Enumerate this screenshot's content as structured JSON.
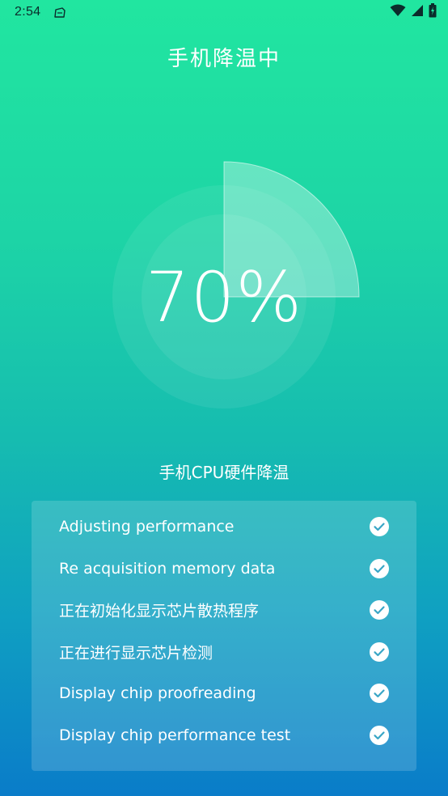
{
  "status_bar": {
    "time": "2:54",
    "icons": [
      "notification-app-icon",
      "wifi-icon",
      "signal-icon",
      "battery-icon"
    ]
  },
  "header": {
    "title": "手机降温中"
  },
  "gauge": {
    "value_text": "70%",
    "progress_fraction": 0.25
  },
  "section": {
    "subtitle": "手机CPU硬件降温"
  },
  "tasks": [
    {
      "label": "Adjusting performance",
      "status": "done"
    },
    {
      "label": "Re acquisition memory data",
      "status": "done"
    },
    {
      "label": "正在初始化显示芯片散热程序",
      "status": "done"
    },
    {
      "label": "正在进行显示芯片检测",
      "status": "done"
    },
    {
      "label": "Display chip proofreading",
      "status": "done"
    },
    {
      "label": "Display chip performance test",
      "status": "done"
    }
  ],
  "colors": {
    "gradient_top": "#21e6a0",
    "gradient_bottom": "#0a7cc9",
    "check_fill": "#ffffff",
    "check_mark": "#3aa6c6"
  }
}
